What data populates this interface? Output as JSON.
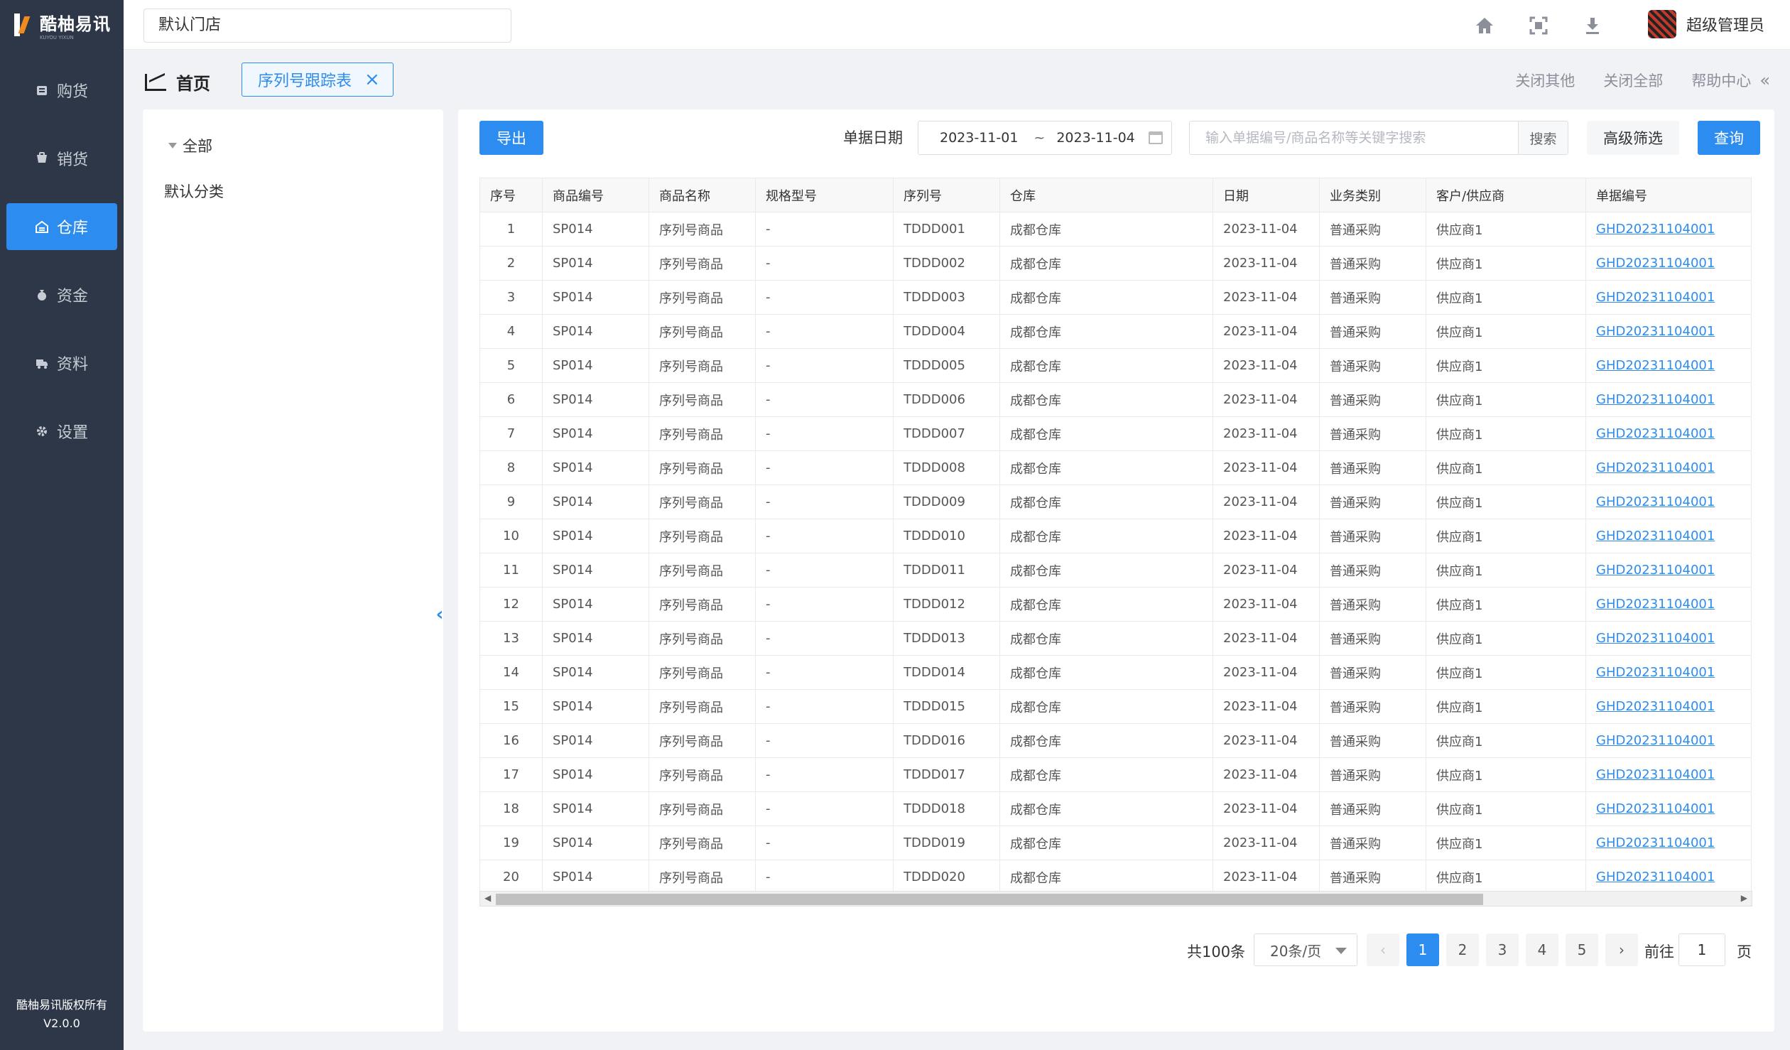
{
  "brand": {
    "name": "酷柚易讯",
    "sub": "KUYOU YIXUN"
  },
  "sidebar": {
    "items": [
      {
        "label": "购货",
        "icon": "purchase-icon",
        "active": false
      },
      {
        "label": "销货",
        "icon": "sales-icon",
        "active": false
      },
      {
        "label": "仓库",
        "icon": "warehouse-icon",
        "active": true
      },
      {
        "label": "资金",
        "icon": "money-bag-icon",
        "active": false
      },
      {
        "label": "资料",
        "icon": "truck-icon",
        "active": false
      },
      {
        "label": "设置",
        "icon": "gear-icon",
        "active": false
      }
    ],
    "copyright": "酷柚易讯版权所有",
    "version": "V2.0.0"
  },
  "header": {
    "store": "默认门店",
    "user_name": "超级管理员"
  },
  "tabbar": {
    "home_label": "首页",
    "active_tab": "序列号跟踪表",
    "close_others": "关闭其他",
    "close_all": "关闭全部",
    "help": "帮助中心",
    "collapse_glyph": "«"
  },
  "categories": {
    "all": "全部",
    "default": "默认分类"
  },
  "toolbar": {
    "export": "导出",
    "date_label": "单据日期",
    "date_start": "2023-11-01",
    "date_sep": "~",
    "date_end": "2023-11-04",
    "search_placeholder": "输入单据编号/商品名称等关键字搜索",
    "search_btn": "搜索",
    "advanced": "高级筛选",
    "query": "查询"
  },
  "table": {
    "columns": [
      "序号",
      "商品编号",
      "商品名称",
      "规格型号",
      "序列号",
      "仓库",
      "日期",
      "业务类别",
      "客户/供应商",
      "单据编号"
    ],
    "rows": [
      [
        "1",
        "SP014",
        "序列号商品",
        "-",
        "TDDD001",
        "成都仓库",
        "2023-11-04",
        "普通采购",
        "供应商1",
        "GHD20231104001"
      ],
      [
        "2",
        "SP014",
        "序列号商品",
        "-",
        "TDDD002",
        "成都仓库",
        "2023-11-04",
        "普通采购",
        "供应商1",
        "GHD20231104001"
      ],
      [
        "3",
        "SP014",
        "序列号商品",
        "-",
        "TDDD003",
        "成都仓库",
        "2023-11-04",
        "普通采购",
        "供应商1",
        "GHD20231104001"
      ],
      [
        "4",
        "SP014",
        "序列号商品",
        "-",
        "TDDD004",
        "成都仓库",
        "2023-11-04",
        "普通采购",
        "供应商1",
        "GHD20231104001"
      ],
      [
        "5",
        "SP014",
        "序列号商品",
        "-",
        "TDDD005",
        "成都仓库",
        "2023-11-04",
        "普通采购",
        "供应商1",
        "GHD20231104001"
      ],
      [
        "6",
        "SP014",
        "序列号商品",
        "-",
        "TDDD006",
        "成都仓库",
        "2023-11-04",
        "普通采购",
        "供应商1",
        "GHD20231104001"
      ],
      [
        "7",
        "SP014",
        "序列号商品",
        "-",
        "TDDD007",
        "成都仓库",
        "2023-11-04",
        "普通采购",
        "供应商1",
        "GHD20231104001"
      ],
      [
        "8",
        "SP014",
        "序列号商品",
        "-",
        "TDDD008",
        "成都仓库",
        "2023-11-04",
        "普通采购",
        "供应商1",
        "GHD20231104001"
      ],
      [
        "9",
        "SP014",
        "序列号商品",
        "-",
        "TDDD009",
        "成都仓库",
        "2023-11-04",
        "普通采购",
        "供应商1",
        "GHD20231104001"
      ],
      [
        "10",
        "SP014",
        "序列号商品",
        "-",
        "TDDD010",
        "成都仓库",
        "2023-11-04",
        "普通采购",
        "供应商1",
        "GHD20231104001"
      ],
      [
        "11",
        "SP014",
        "序列号商品",
        "-",
        "TDDD011",
        "成都仓库",
        "2023-11-04",
        "普通采购",
        "供应商1",
        "GHD20231104001"
      ],
      [
        "12",
        "SP014",
        "序列号商品",
        "-",
        "TDDD012",
        "成都仓库",
        "2023-11-04",
        "普通采购",
        "供应商1",
        "GHD20231104001"
      ],
      [
        "13",
        "SP014",
        "序列号商品",
        "-",
        "TDDD013",
        "成都仓库",
        "2023-11-04",
        "普通采购",
        "供应商1",
        "GHD20231104001"
      ],
      [
        "14",
        "SP014",
        "序列号商品",
        "-",
        "TDDD014",
        "成都仓库",
        "2023-11-04",
        "普通采购",
        "供应商1",
        "GHD20231104001"
      ],
      [
        "15",
        "SP014",
        "序列号商品",
        "-",
        "TDDD015",
        "成都仓库",
        "2023-11-04",
        "普通采购",
        "供应商1",
        "GHD20231104001"
      ],
      [
        "16",
        "SP014",
        "序列号商品",
        "-",
        "TDDD016",
        "成都仓库",
        "2023-11-04",
        "普通采购",
        "供应商1",
        "GHD20231104001"
      ],
      [
        "17",
        "SP014",
        "序列号商品",
        "-",
        "TDDD017",
        "成都仓库",
        "2023-11-04",
        "普通采购",
        "供应商1",
        "GHD20231104001"
      ],
      [
        "18",
        "SP014",
        "序列号商品",
        "-",
        "TDDD018",
        "成都仓库",
        "2023-11-04",
        "普通采购",
        "供应商1",
        "GHD20231104001"
      ],
      [
        "19",
        "SP014",
        "序列号商品",
        "-",
        "TDDD019",
        "成都仓库",
        "2023-11-04",
        "普通采购",
        "供应商1",
        "GHD20231104001"
      ],
      [
        "20",
        "SP014",
        "序列号商品",
        "-",
        "TDDD020",
        "成都仓库",
        "2023-11-04",
        "普通采购",
        "供应商1",
        "GHD20231104001"
      ]
    ]
  },
  "pagination": {
    "total": "共100条",
    "page_size": "20条/页",
    "pages": [
      "1",
      "2",
      "3",
      "4",
      "5"
    ],
    "current": "1",
    "goto_label": "前往",
    "goto_value": "1",
    "goto_suffix": "页"
  },
  "colors": {
    "primary": "#2d8cf0",
    "sidebar_bg": "#2e3748"
  }
}
